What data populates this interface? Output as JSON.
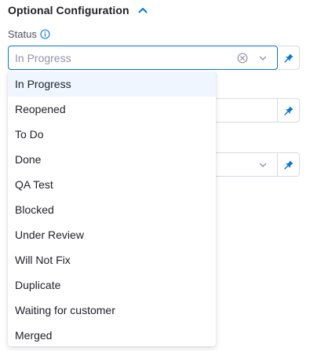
{
  "section": {
    "title": "Optional Configuration"
  },
  "status_field": {
    "label": "Status",
    "placeholder": "In Progress"
  },
  "dropdown": {
    "options": [
      "In Progress",
      "Reopened",
      "To Do",
      "Done",
      "QA Test",
      "Blocked",
      "Under Review",
      "Will Not Fix",
      "Duplicate",
      "Waiting for customer",
      "Merged"
    ],
    "highlighted_index": 0
  },
  "colors": {
    "accent": "#0278d5",
    "text": "#22222a",
    "muted": "#9293ab",
    "border": "#d9dae5",
    "highlight": "#eff6ff"
  }
}
